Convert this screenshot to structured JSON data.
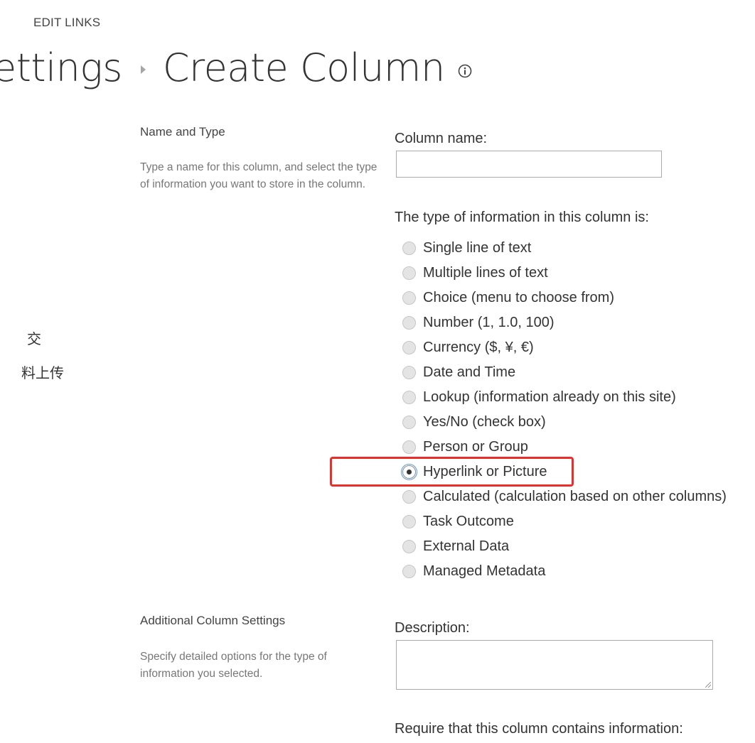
{
  "header": {
    "edit_links": "EDIT LINKS",
    "breadcrumb_parent": "ettings",
    "page_title": "Create Column",
    "info_icon": "info-icon"
  },
  "left_nav": {
    "item1": "交",
    "item2": "料上传"
  },
  "name_and_type": {
    "section_title": "Name and Type",
    "section_description": "Type a name for this column, and select the type of information you want to store in the column.",
    "column_name_label": "Column name:",
    "column_name_value": "",
    "type_label": "The type of information in this column is:",
    "types": [
      "Single line of text",
      "Multiple lines of text",
      "Choice (menu to choose from)",
      "Number (1, 1.0, 100)",
      "Currency ($, ¥, €)",
      "Date and Time",
      "Lookup (information already on this site)",
      "Yes/No (check box)",
      "Person or Group",
      "Hyperlink or Picture",
      "Calculated (calculation based on other columns)",
      "Task Outcome",
      "External Data",
      "Managed Metadata"
    ],
    "selected_type": "Hyperlink or Picture"
  },
  "additional_settings": {
    "section_title": "Additional Column Settings",
    "section_description": "Specify detailed options for the type of information you selected.",
    "description_label": "Description:",
    "description_value": "",
    "require_label": "Require that this column contains information:"
  },
  "colors": {
    "highlight": "#e8302a",
    "focus": "#5b9bd5"
  }
}
